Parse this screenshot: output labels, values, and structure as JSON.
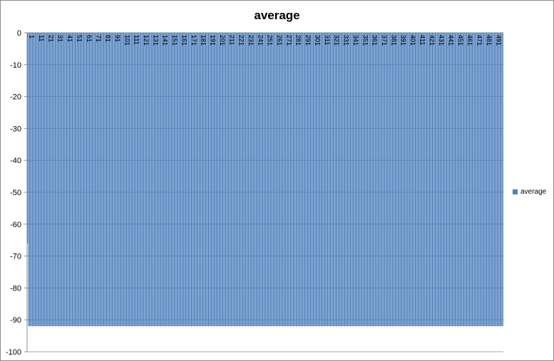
{
  "chart_data": {
    "type": "bar",
    "title": "average",
    "xlabel": "",
    "ylabel": "",
    "x_range": [
      1,
      500
    ],
    "x_tick_labels": [
      "1",
      "11",
      "21",
      "31",
      "41",
      "51",
      "61",
      "71",
      "81",
      "91",
      "101",
      "111",
      "121",
      "131",
      "141",
      "151",
      "161",
      "171",
      "181",
      "191",
      "201",
      "211",
      "221",
      "231",
      "241",
      "251",
      "261",
      "271",
      "281",
      "291",
      "301",
      "311",
      "321",
      "331",
      "341",
      "351",
      "361",
      "371",
      "381",
      "391",
      "401",
      "411",
      "421",
      "431",
      "441",
      "451",
      "461",
      "471",
      "481",
      "491"
    ],
    "ylim": [
      -100,
      0
    ],
    "y_ticks": [
      0,
      -10,
      -20,
      -30,
      -40,
      -50,
      -60,
      -70,
      -80,
      -90,
      -100
    ],
    "y_tick_labels": [
      "0",
      "-10",
      "-20",
      "-30",
      "-40",
      "-50",
      "-60",
      "-70",
      "-80",
      "-90",
      "-100"
    ],
    "series": [
      {
        "name": "average",
        "color": "#4f81bd",
        "value_all_categories": -92,
        "values_first": [
          -66,
          -92,
          -92
        ]
      }
    ],
    "gridlines": true,
    "legend_position": "right"
  }
}
